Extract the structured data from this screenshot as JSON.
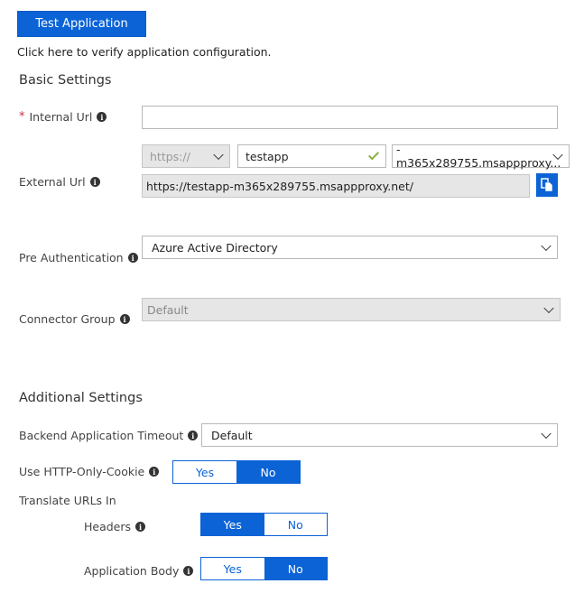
{
  "test_button": "Test Application",
  "hint": "Click here to verify application configuration.",
  "basic": {
    "title": "Basic Settings",
    "internal_url": {
      "label": "Internal Url",
      "required_mark": "*",
      "value": ""
    },
    "external_url": {
      "label": "External Url",
      "scheme": "https://",
      "subdomain": "testapp",
      "domain": "-m365x289755.msappproxy...",
      "full": "https://testapp-m365x289755.msappproxy.net/"
    },
    "pre_auth": {
      "label": "Pre Authentication",
      "value": "Azure Active Directory"
    },
    "connector_group": {
      "label": "Connector Group",
      "value": "Default"
    }
  },
  "additional": {
    "title": "Additional Settings",
    "backend_timeout": {
      "label": "Backend Application Timeout",
      "value": "Default"
    },
    "http_only_cookie": {
      "label": "Use HTTP-Only-Cookie",
      "yes": "Yes",
      "no": "No",
      "selected": "No"
    },
    "translate_urls": {
      "label": "Translate URLs In",
      "headers": {
        "label": "Headers",
        "yes": "Yes",
        "no": "No",
        "selected": "Yes"
      },
      "body": {
        "label": "Application Body",
        "yes": "Yes",
        "no": "No",
        "selected": "No"
      }
    }
  },
  "icons": {
    "info": "info-icon",
    "copy": "copy-icon",
    "chevron": "chevron-down-icon",
    "check": "checkmark-icon"
  },
  "colors": {
    "accent": "#0b63d6",
    "required": "#c4314b",
    "valid": "#8cb043"
  }
}
